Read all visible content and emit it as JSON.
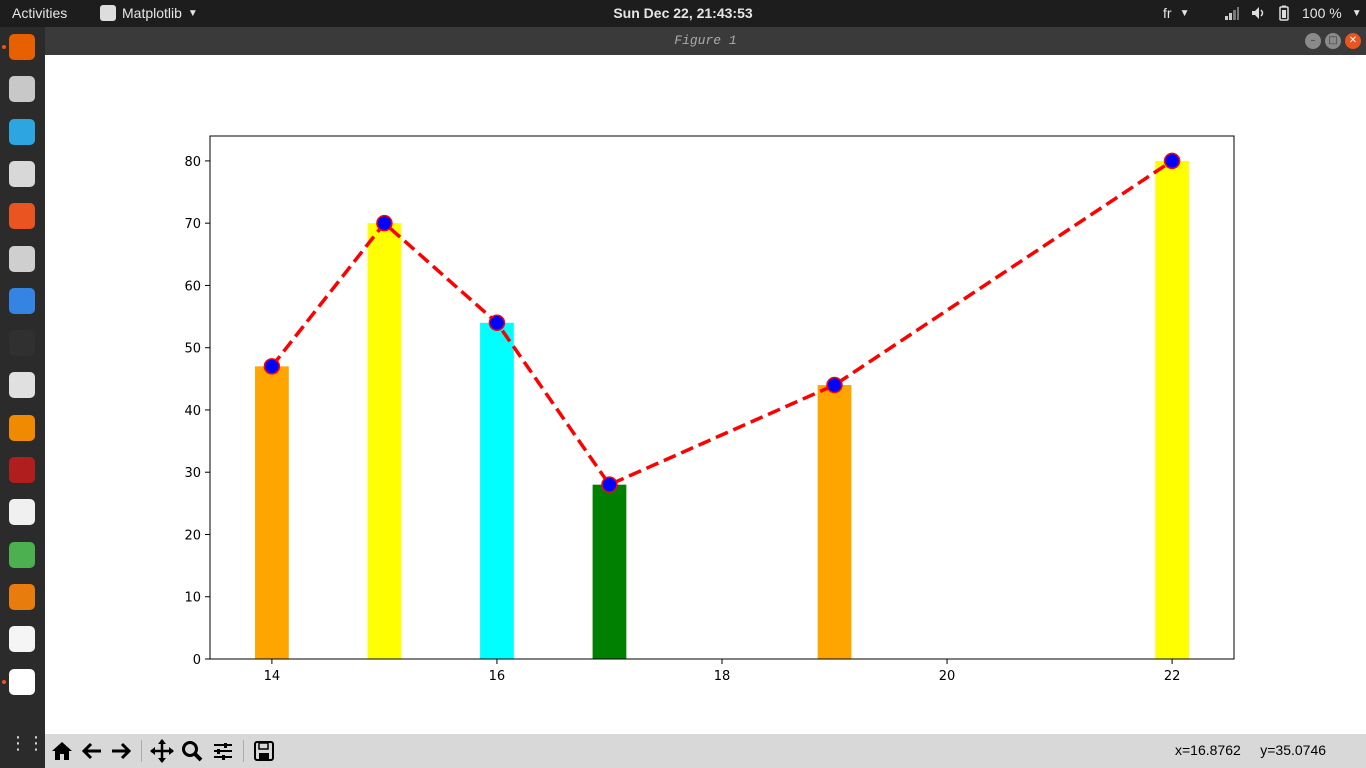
{
  "topbar": {
    "activities_label": "Activities",
    "app_name": "Matplotlib",
    "clock": "Sun Dec 22, 21:43:53",
    "language": "fr",
    "battery": "100 %"
  },
  "dock": {
    "items": [
      "firefox-icon",
      "files-icon",
      "telegram-icon",
      "speaker-icon",
      "software-center-icon",
      "terminal-settings-icon",
      "help-icon",
      "terminal-icon",
      "apps-icon",
      "vlc-icon",
      "media-icon",
      "editor-icon",
      "colors-icon",
      "blender-icon",
      "text-editor-icon",
      "matplotlib-icon",
      "show-apps-icon"
    ]
  },
  "window": {
    "title": "Figure 1"
  },
  "chart_data": {
    "type": "bar",
    "x": [
      14,
      15,
      16,
      17,
      19,
      22
    ],
    "values": [
      47,
      70,
      54,
      28,
      44,
      80
    ],
    "bar_colors": [
      "#ffa500",
      "#ffff00",
      "#00ffff",
      "#008000",
      "#ffa500",
      "#ffff00"
    ],
    "line": {
      "x": [
        14,
        15,
        16,
        17,
        19,
        22
      ],
      "y": [
        47,
        70,
        54,
        28,
        44,
        80
      ],
      "color": "#ff0000",
      "style": "dashed",
      "marker_face": "#0000ff",
      "marker_edge": "#ff0000"
    },
    "xticks": [
      "14",
      "16",
      "18",
      "20",
      "22"
    ],
    "yticks": [
      "0",
      "10",
      "20",
      "30",
      "40",
      "50",
      "60",
      "70",
      "80"
    ],
    "xlim": [
      13.45,
      22.55
    ],
    "ylim": [
      0,
      84
    ],
    "title": "",
    "xlabel": "",
    "ylabel": "",
    "grid": false
  },
  "toolbar": {
    "buttons": [
      "home-icon",
      "back-icon",
      "forward-icon",
      "pan-icon",
      "zoom-icon",
      "configure-icon",
      "save-icon"
    ],
    "coords_x": "x=16.8762",
    "coords_y": "y=35.0746"
  }
}
